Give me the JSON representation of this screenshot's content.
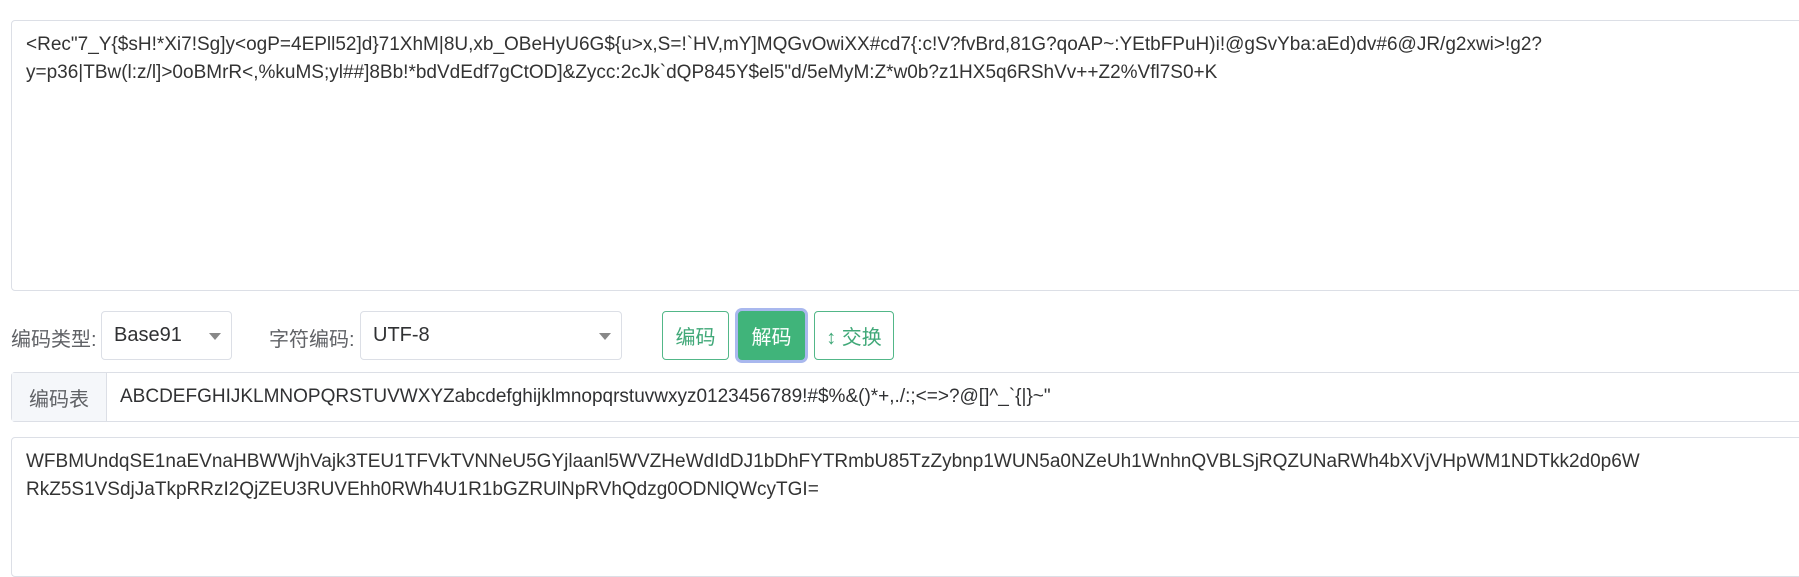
{
  "input": {
    "lines": [
      "<Rec\"7_Y{$sH!*Xi7!Sg]y<ogP=4EPll52]d}71XhM|8U,xb_OBeHyU6G${u>x,S=!`HV,mY]MQGvOwiXX#cd7{:c!V?fvBrd,81G?qoAP~:YEtbFPuH)i!@gSvYba:aEd)dv#6@JR/g2xwi>!g2?",
      "y=p36|TBw(l:z/l]>0oBMrR<,%kuMS;yl##]8Bb!*bdVdEdf7gCtOD]&Zycc:2cJk`dQP845Y$el5\"d/5eMyM:Z*w0b?z1HX5q6RShVv++Z2%Vfl7S0+K"
    ]
  },
  "controls": {
    "encode_type_label": "编码类型:",
    "encode_type_value": "Base91",
    "charset_label": "字符编码:",
    "charset_value": "UTF-8",
    "encode_button": "编码",
    "decode_button": "解码",
    "swap_button": "↕ 交换"
  },
  "table": {
    "label": "编码表",
    "value": "ABCDEFGHIJKLMNOPQRSTUVWXYZabcdefghijklmnopqrstuvwxyz0123456789!#$%&()*+,./:;<=>?@[]^_`{|}~\""
  },
  "output": {
    "lines": [
      "WFBMUndqSE1naEVnaHBWWjhVajk3TEU1TFVkTVNNeU5GYjlaanl5WVZHeWdIdDJ1bDhFYTRmbU85TzZybnp1WUN5a0NZeUh1WnhnQVBLSjRQZUNaRWh4bXVjVHpWM1NDTkk2d0p6W",
      "RkZ5S1VSdjJaTkpRRzI2QjZEU3RUVEhh0RWh4U1R1bGZRUlNpRVhQdzg0ODNlQWcyTGI="
    ]
  },
  "colors": {
    "accent": "#40b47a",
    "focus_ring": "#a9b8ee",
    "border": "#dcdfe6"
  }
}
